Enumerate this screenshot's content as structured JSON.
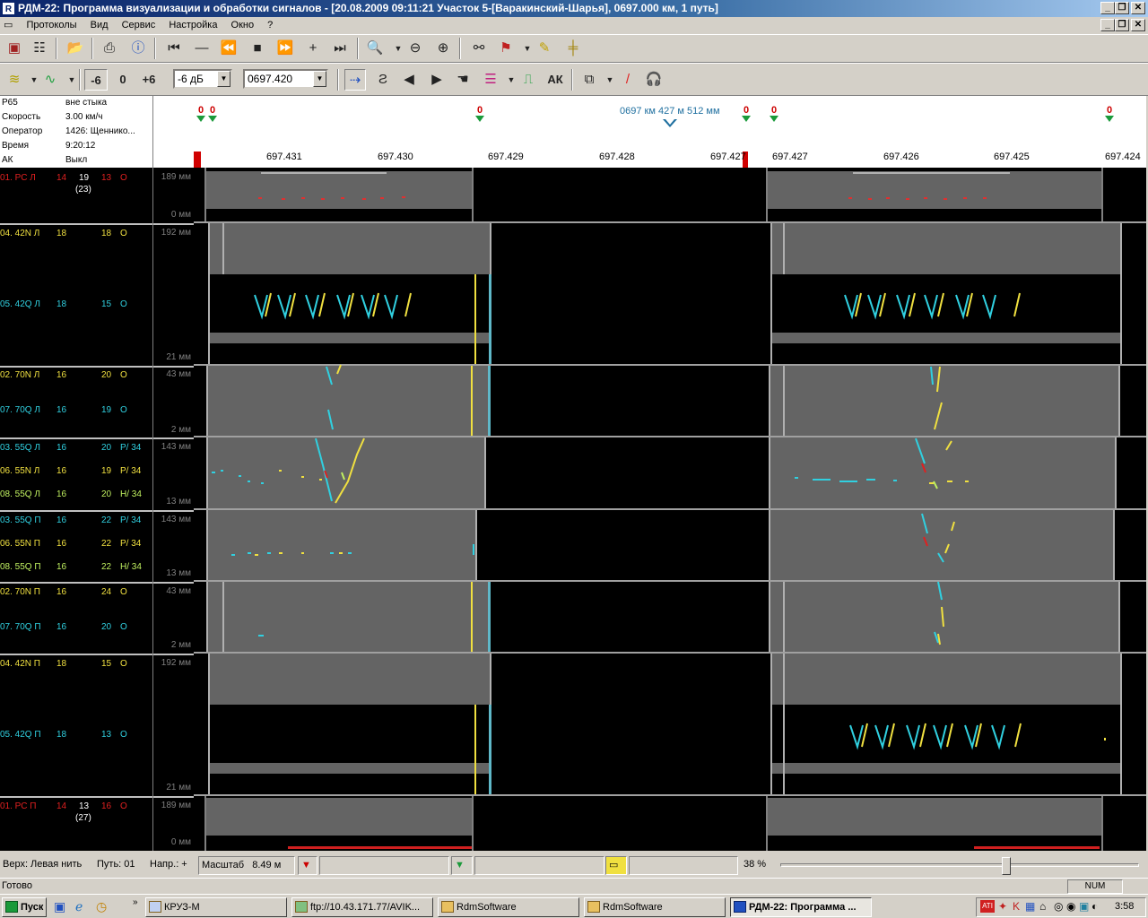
{
  "window": {
    "title": "РДМ-22: Программа визуализации и обработки сигналов - [20.08.2009 09:11:21 Участок 5-[Варакинский-Шарья], 0697.000 км, 1 путь]",
    "icon": "rdm-app-icon"
  },
  "menu": [
    "Протоколы",
    "Вид",
    "Сервис",
    "Настройка",
    "Окно",
    "?"
  ],
  "toolbar2": {
    "minus6": "-6",
    "zero": "0",
    "plus6": "+6",
    "gain_value": "-6 дБ",
    "coord_value": "0697.420",
    "ak_label": "АК"
  },
  "info": [
    {
      "label": "Р65",
      "value": "вне стыка"
    },
    {
      "label": "Скорость",
      "value": "3.00 км/ч"
    },
    {
      "label": "Оператор",
      "value": "1426: Щеннико..."
    },
    {
      "label": "Время",
      "value": "9:20:12"
    },
    {
      "label": "АК",
      "value": "Выкл"
    }
  ],
  "header": {
    "position_label": "0697 км 427 м 512 мм",
    "marker_label": "0",
    "ticks": [
      "697.431",
      "697.430",
      "697.429",
      "697.428",
      "697.427",
      "697.427",
      "697.426",
      "697.425",
      "697.424"
    ]
  },
  "channels": [
    {
      "name": "01. РС Л",
      "a": "14",
      "b": "19",
      "b2": "(23)",
      "c": "13",
      "d": "О",
      "color": "#e02020",
      "scale_top": "189 мм",
      "scale_bot": "0 мм"
    },
    {
      "name": "04. 42N Л",
      "a": "18",
      "c": "18",
      "d": "О",
      "color": "#f0e040",
      "scale_top": "192 мм"
    },
    {
      "name": "05. 42Q Л",
      "a": "18",
      "c": "15",
      "d": "О",
      "color": "#30d0e0",
      "scale_bot": "21 мм"
    },
    {
      "name": "02. 70N Л",
      "a": "16",
      "c": "20",
      "d": "О",
      "color": "#f0e040",
      "scale_top": "43 мм"
    },
    {
      "name": "07. 70Q Л",
      "a": "16",
      "c": "19",
      "d": "О",
      "color": "#30d0e0",
      "scale_bot": "2 мм"
    },
    {
      "name": "03. 55Q Л",
      "a": "16",
      "c": "20",
      "d": "Р/ 34",
      "color": "#30d0e0",
      "scale_top": "143 мм"
    },
    {
      "name": "06. 55N Л",
      "a": "16",
      "c": "19",
      "d": "Р/ 34",
      "color": "#f0e040"
    },
    {
      "name": "08. 55Q Л",
      "a": "16",
      "c": "20",
      "d": "Н/ 34",
      "color": "#c0f060",
      "scale_bot": "13 мм"
    },
    {
      "name": "03. 55Q П",
      "a": "16",
      "c": "22",
      "d": "Р/ 34",
      "color": "#30d0e0",
      "scale_top": "143 мм"
    },
    {
      "name": "06. 55N П",
      "a": "16",
      "c": "22",
      "d": "Р/ 34",
      "color": "#f0e040"
    },
    {
      "name": "08. 55Q П",
      "a": "16",
      "c": "22",
      "d": "Н/ 34",
      "color": "#c0f060",
      "scale_bot": "13 мм"
    },
    {
      "name": "02. 70N П",
      "a": "16",
      "c": "24",
      "d": "О",
      "color": "#f0e040",
      "scale_top": "43 мм"
    },
    {
      "name": "07. 70Q П",
      "a": "16",
      "c": "20",
      "d": "О",
      "color": "#30d0e0",
      "scale_bot": "2 мм"
    },
    {
      "name": "04. 42N П",
      "a": "18",
      "c": "15",
      "d": "О",
      "color": "#f0e040",
      "scale_top": "192 мм"
    },
    {
      "name": "05. 42Q П",
      "a": "18",
      "c": "13",
      "d": "О",
      "color": "#30d0e0",
      "scale_bot": "21 мм"
    },
    {
      "name": "01. РС П",
      "a": "14",
      "b": "13",
      "b2": "(27)",
      "c": "16",
      "d": "О",
      "color": "#e02020",
      "scale_top": "189 мм",
      "scale_bot": "0 мм"
    }
  ],
  "status": {
    "thread": "Верх: Левая нить",
    "path": "Путь:  01",
    "direction": "Напр.: +",
    "scale_label": "Масштаб",
    "scale_value": "8.49 м",
    "percent": "38 %",
    "ready": "Готово",
    "num": "NUM",
    "slider_fraction": 0.63
  },
  "taskbar": {
    "start": "Пуск",
    "tasks": [
      "КРУЗ-М",
      "ftp://10.43.171.77/AVIK...",
      "RdmSoftware",
      "RdmSoftware",
      "РДМ-22: Программа ..."
    ],
    "clock": "3:58"
  }
}
